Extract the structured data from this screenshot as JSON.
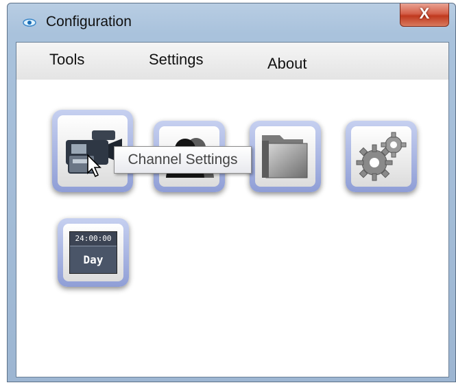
{
  "window": {
    "title": "Configuration",
    "close_glyph": "X"
  },
  "menu": {
    "items": [
      {
        "id": "tools",
        "label": "Tools"
      },
      {
        "id": "settings",
        "label": "Settings"
      },
      {
        "id": "about",
        "label": "About"
      }
    ]
  },
  "tiles": [
    {
      "id": "channel-settings",
      "icon": "video-camera-icon"
    },
    {
      "id": "users",
      "icon": "users-icon"
    },
    {
      "id": "folder",
      "icon": "folder-icon"
    },
    {
      "id": "system-settings",
      "icon": "gears-icon"
    },
    {
      "id": "day-schedule",
      "icon": "clock-day-icon",
      "clock_text": "24:00:00",
      "day_text": "Day"
    }
  ],
  "tooltip": {
    "text": "Channel Settings"
  },
  "colors": {
    "tile_border": "#8f9ed6",
    "close_button": "#c0391f",
    "title_bar": "#a9c2dc"
  }
}
